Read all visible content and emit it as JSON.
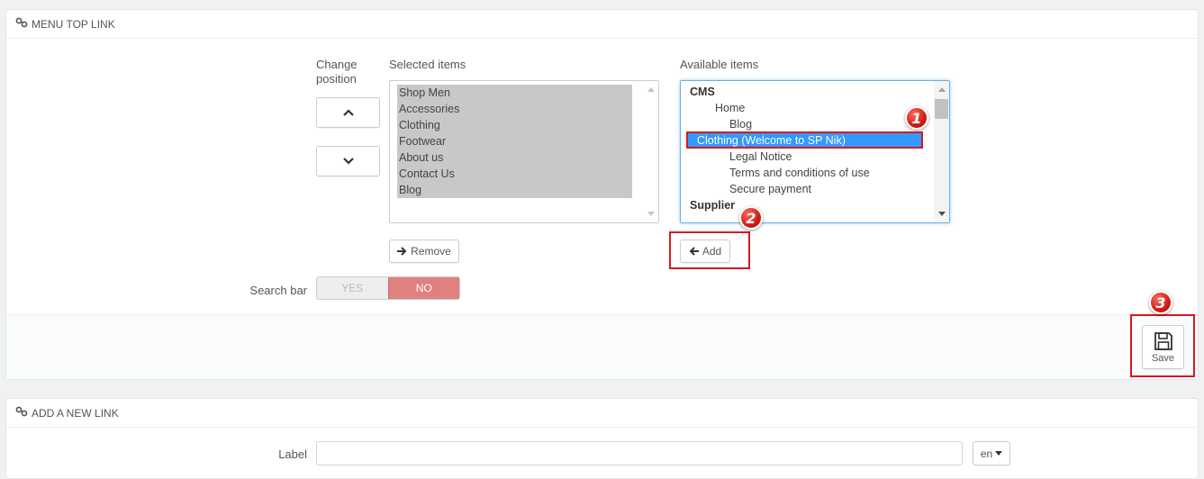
{
  "menu_panel": {
    "title": "MENU TOP LINK",
    "change_position_label": "Change position",
    "change_position_line1": "Change",
    "change_position_line2": "position",
    "selected_items_label": "Selected items",
    "available_items_label": "Available items",
    "selected_items": [
      "Shop Men",
      "Accessories",
      "Clothing",
      "Footwear",
      "About us",
      "Contact Us",
      "Blog"
    ],
    "available_items": [
      {
        "text": "CMS",
        "type": "group",
        "indent": 0
      },
      {
        "text": "Home",
        "type": "item",
        "indent": 1
      },
      {
        "text": "Blog",
        "type": "item",
        "indent": 2
      },
      {
        "text": "Clothing (Welcome to SP Nik)",
        "type": "item",
        "indent": 0,
        "selected": true
      },
      {
        "text": "Legal Notice",
        "type": "item",
        "indent": 2
      },
      {
        "text": "Terms and conditions of use",
        "type": "item",
        "indent": 2
      },
      {
        "text": "Secure payment",
        "type": "item",
        "indent": 2
      },
      {
        "text": "Supplier",
        "type": "group",
        "indent": 0
      }
    ],
    "remove_button": "Remove",
    "add_button": "Add",
    "search_bar_label": "Search bar",
    "toggle_yes": "YES",
    "toggle_no": "NO",
    "toggle_value": "NO",
    "save_button": "Save"
  },
  "annotations": {
    "badge1": "1",
    "badge2": "2",
    "badge3": "3",
    "highlight_color": "#d71920"
  },
  "new_link_panel": {
    "title": "ADD A NEW LINK",
    "label_field_label": "Label",
    "label_value": "",
    "language": "en"
  },
  "colors": {
    "selected_row": "#3399ff",
    "toggle_no": "#e08080",
    "selected_items_bg": "#c8c8c8"
  }
}
